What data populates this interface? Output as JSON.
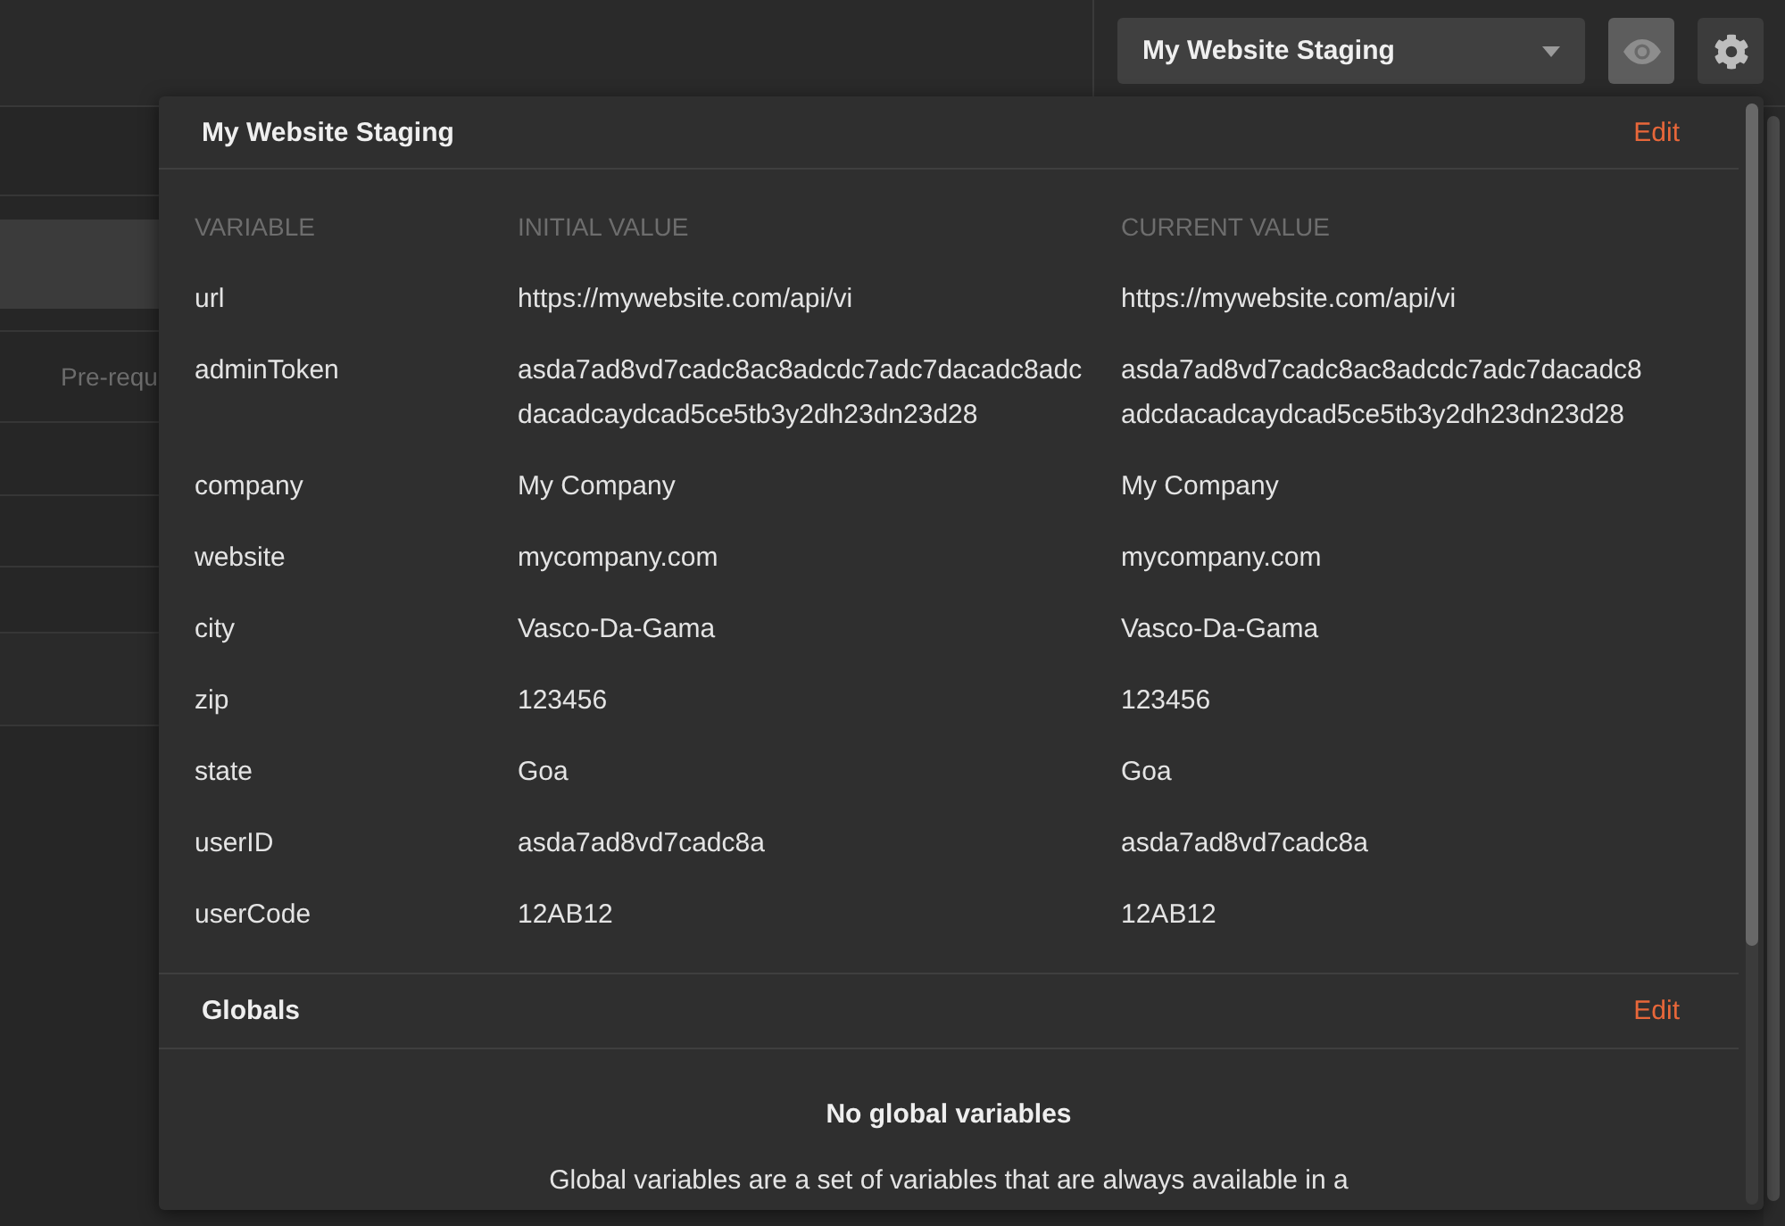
{
  "top_bar": {
    "environment_selector": {
      "value": "My Website Staging"
    },
    "quick_look_button": {
      "active": true
    }
  },
  "request_panel": {
    "tab_label": "Pre-requ"
  },
  "environment_popup": {
    "title": "My Website Staging",
    "edit_link": "Edit",
    "columns": [
      "VARIABLE",
      "INITIAL VALUE",
      "CURRENT VALUE"
    ],
    "variables": [
      {
        "name": "url",
        "initial_value": "https://mywebsite.com/api/vi",
        "current_value": "https://mywebsite.com/api/vi"
      },
      {
        "name": "adminToken",
        "initial_value": "asda7ad8vd7cadc8ac8adcdc7adc7dacadc8adcdacadcaydcad5ce5tb3y2dh23dn23d28",
        "current_value": "asda7ad8vd7cadc8ac8adcdc7adc7dacadc8adcdacadcaydcad5ce5tb3y2dh23dn23d28"
      },
      {
        "name": "company",
        "initial_value": "My Company",
        "current_value": "My Company"
      },
      {
        "name": "website",
        "initial_value": "mycompany.com",
        "current_value": "mycompany.com"
      },
      {
        "name": "city",
        "initial_value": "Vasco-Da-Gama",
        "current_value": "Vasco-Da-Gama"
      },
      {
        "name": "zip",
        "initial_value": "123456",
        "current_value": "123456"
      },
      {
        "name": "state",
        "initial_value": "Goa",
        "current_value": "Goa"
      },
      {
        "name": "userID",
        "initial_value": "asda7ad8vd7cadc8a",
        "current_value": "asda7ad8vd7cadc8a"
      },
      {
        "name": "userCode",
        "initial_value": "12AB12",
        "current_value": "12AB12"
      }
    ]
  },
  "globals": {
    "title": "Globals",
    "edit_link": "Edit",
    "empty_title": "No global variables",
    "empty_text": "Global variables are a set of variables that are always available in a"
  }
}
